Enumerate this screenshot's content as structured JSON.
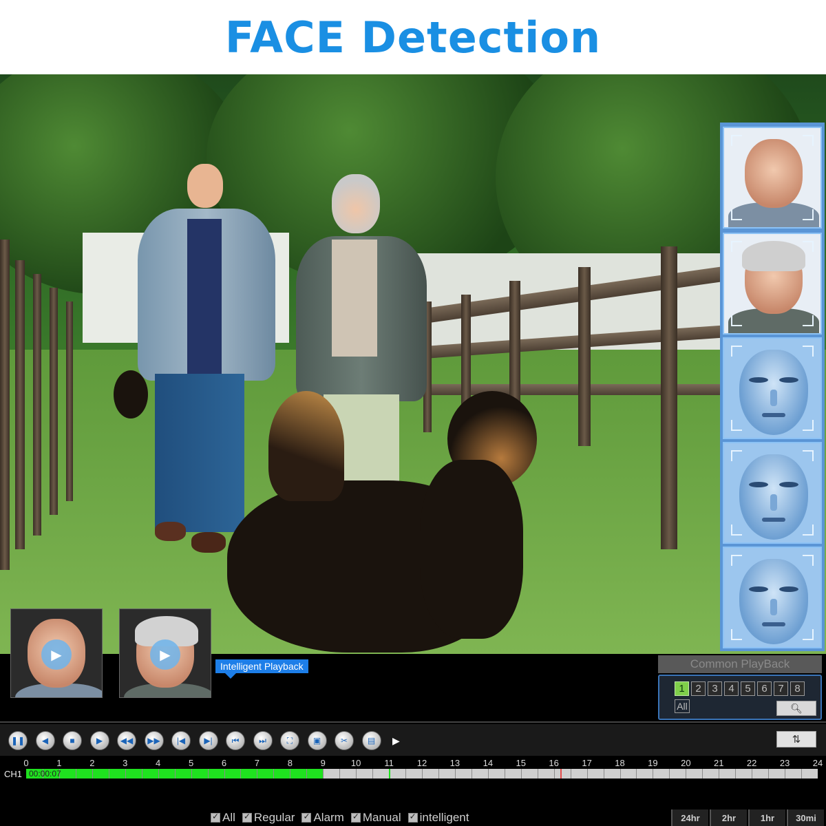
{
  "page": {
    "title": "FACE Detection"
  },
  "colors": {
    "title": "#1a8fe3",
    "accent": "#1d7ee8",
    "timeline_fill": "#1fe21f"
  },
  "thumbnails": [
    {
      "name": "face-thumb-man",
      "icon": "play-icon"
    },
    {
      "name": "face-thumb-woman",
      "icon": "play-icon"
    }
  ],
  "intelligent_label": "Intelligent Playback",
  "common_playback": {
    "title": "Common PlayBack",
    "channels": [
      "1",
      "2",
      "3",
      "4",
      "5",
      "6",
      "7",
      "8"
    ],
    "active_channel": "1",
    "all_label": "All",
    "search_icon": "search-icon"
  },
  "controls": {
    "buttons": [
      {
        "name": "pause-button",
        "icon": "pause-icon",
        "glyph": "❚❚"
      },
      {
        "name": "reverse-play-button",
        "icon": "reverse-icon",
        "glyph": "◀"
      },
      {
        "name": "stop-button",
        "icon": "stop-icon",
        "glyph": "■"
      },
      {
        "name": "play-button",
        "icon": "play-icon",
        "glyph": "▶"
      },
      {
        "name": "rewind-button",
        "icon": "rewind-icon",
        "glyph": "◀◀"
      },
      {
        "name": "fast-forward-button",
        "icon": "fast-forward-icon",
        "glyph": "▶▶"
      },
      {
        "name": "previous-frame-button",
        "icon": "previous-icon",
        "glyph": "|◀"
      },
      {
        "name": "next-frame-button",
        "icon": "next-icon",
        "glyph": "▶|"
      },
      {
        "name": "previous-segment-button",
        "icon": "skip-back-icon",
        "glyph": "⏮"
      },
      {
        "name": "next-segment-button",
        "icon": "skip-forward-icon",
        "glyph": "⏭"
      },
      {
        "name": "fullscreen-button",
        "icon": "fullscreen-icon",
        "glyph": "⛶"
      },
      {
        "name": "multi-view-button",
        "icon": "multi-view-icon",
        "glyph": "▣"
      },
      {
        "name": "clip-button",
        "icon": "scissors-icon",
        "glyph": "✂"
      },
      {
        "name": "save-button",
        "icon": "save-icon",
        "glyph": "▤"
      }
    ],
    "sync_icon": "sync-icon"
  },
  "timeline": {
    "hours": [
      "0",
      "1",
      "2",
      "3",
      "4",
      "5",
      "6",
      "7",
      "8",
      "9",
      "10",
      "11",
      "12",
      "13",
      "14",
      "15",
      "16",
      "17",
      "18",
      "19",
      "20",
      "21",
      "22",
      "23",
      "24"
    ],
    "channel_label": "CH1",
    "current_time": "00:00:07",
    "recorded_fraction": 0.375,
    "marks": [
      {
        "hour": 11.0,
        "color": "#1fe21f"
      },
      {
        "hour": 16.2,
        "color": "#e24a4a"
      }
    ]
  },
  "filters": [
    "All",
    "Regular",
    "Alarm",
    "Manual",
    "intelligent"
  ],
  "zoom_buttons": [
    "24hr",
    "2hr",
    "1hr",
    "30mi"
  ]
}
